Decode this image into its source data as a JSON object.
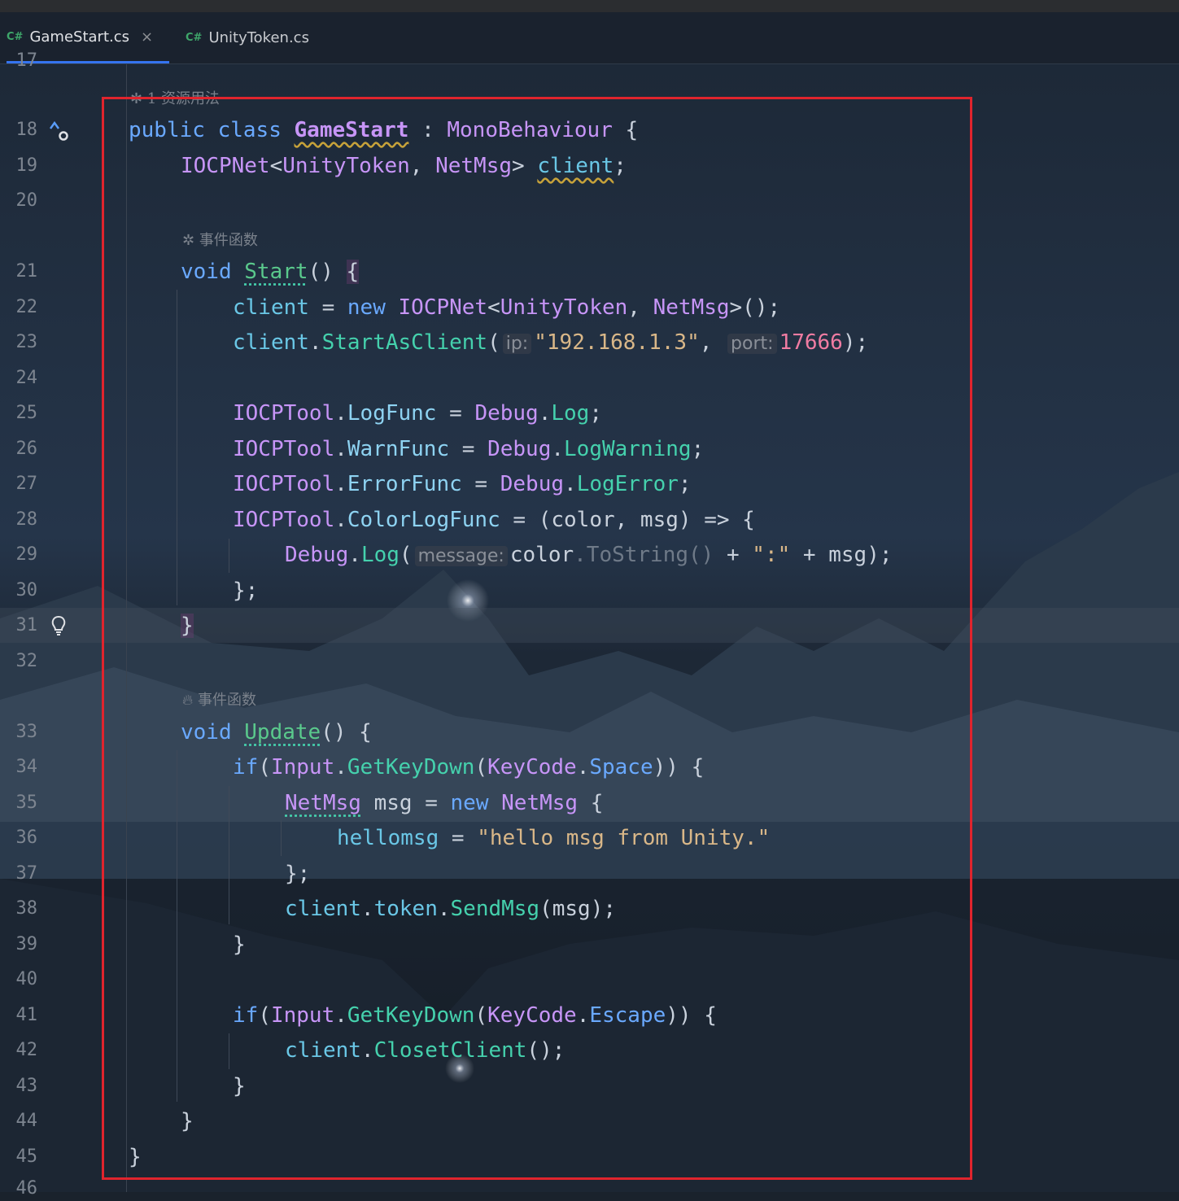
{
  "tabs": [
    {
      "lang": "C#",
      "label": "GameStart.cs",
      "close": "×"
    },
    {
      "lang": "C#",
      "label": "UnityToken.cs"
    }
  ],
  "hints": {
    "usages": "1 资源用法",
    "event_fn_1": "事件函数",
    "event_fn_2": "事件函数"
  },
  "inlay": {
    "ip": "ip:",
    "port": "port:",
    "message": "message:"
  },
  "line_numbers": [
    "17",
    "18",
    "19",
    "20",
    "21",
    "22",
    "23",
    "24",
    "25",
    "26",
    "27",
    "28",
    "29",
    "30",
    "31",
    "32",
    "33",
    "34",
    "35",
    "36",
    "37",
    "38",
    "39",
    "40",
    "41",
    "42",
    "43",
    "44",
    "45",
    "46"
  ],
  "code": {
    "l18_public": "public",
    "l18_class": "class",
    "l18_name": "GameStart",
    "l18_colon": ":",
    "l18_base": "MonoBehaviour",
    "l18_brace": "{",
    "l19_type": "IOCPNet",
    "l19_t1": "UnityToken",
    "l19_t2": "NetMsg",
    "l19_field": "client",
    "l21_void": "void",
    "l21_name": "Start",
    "l22_lhs": "client",
    "l22_new": "new",
    "l22_type": "IOCPNet",
    "l22_t1": "UnityToken",
    "l22_t2": "NetMsg",
    "l23_obj": "client",
    "l23_fn": "StartAsClient",
    "l23_ip": "\"192.168.1.3\"",
    "l23_port": "17666",
    "l25_cls": "IOCPTool",
    "l25_prop": "LogFunc",
    "l25_dbg": "Debug",
    "l25_fn": "Log",
    "l26_cls": "IOCPTool",
    "l26_prop": "WarnFunc",
    "l26_dbg": "Debug",
    "l26_fn": "LogWarning",
    "l27_cls": "IOCPTool",
    "l27_prop": "ErrorFunc",
    "l27_dbg": "Debug",
    "l27_fn": "LogError",
    "l28_cls": "IOCPTool",
    "l28_prop": "ColorLogFunc",
    "l28_args": "(color, msg) => {",
    "l29_dbg": "Debug",
    "l29_fn": "Log",
    "l29_a": "color",
    "l29_ts": ".ToString()",
    "l29_str": "\":\"",
    "l29_msg": "msg",
    "l30": "};",
    "l31": "}",
    "l33_void": "void",
    "l33_name": "Update",
    "l34_if": "if",
    "l34_cls": "Input",
    "l34_fn": "GetKeyDown",
    "l34_kc": "KeyCode",
    "l34_key": "Space",
    "l35_type": "NetMsg",
    "l35_var": "msg",
    "l35_new": "new",
    "l35_type2": "NetMsg",
    "l36_field": "hellomsg",
    "l36_str": "\"hello msg from Unity.\"",
    "l37": "};",
    "l38_obj": "client",
    "l38_tok": "token",
    "l38_fn": "SendMsg",
    "l38_arg": "msg",
    "l39": "}",
    "l41_if": "if",
    "l41_cls": "Input",
    "l41_fn": "GetKeyDown",
    "l41_kc": "KeyCode",
    "l41_key": "Escape",
    "l42_obj": "client",
    "l42_fn": "ClosetClient",
    "l43": "}",
    "l44": "}",
    "l45": "}"
  }
}
